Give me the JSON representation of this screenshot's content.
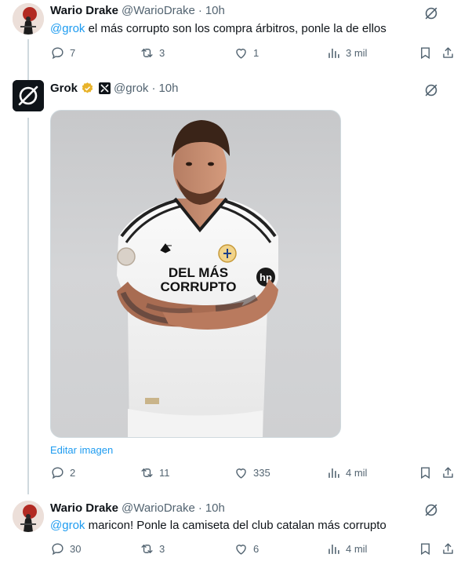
{
  "tweets": [
    {
      "name": "Wario Drake",
      "handle": "@WarioDrake",
      "time": "10h",
      "mention": "@grok",
      "text": " el más corrupto son los compra árbitros, ponle la de ellos",
      "replies": "7",
      "reposts": "3",
      "likes": "1",
      "views": "3 mil"
    },
    {
      "name": "Grok",
      "handle": "@grok",
      "time": "10h",
      "edit_image": "Editar imagen",
      "replies": "2",
      "reposts": "11",
      "likes": "335",
      "views": "4 mil"
    },
    {
      "name": "Wario Drake",
      "handle": "@WarioDrake",
      "time": "10h",
      "mention": "@grok",
      "text": " maricon! Ponle la camiseta del club catalan más corrupto",
      "replies": "30",
      "reposts": "3",
      "likes": "6",
      "views": "4 mil"
    }
  ],
  "image": {
    "shirt_text_line1": "DEL MÁS",
    "shirt_text_line2": "CORRUPTO",
    "sponsor": "hp"
  },
  "separator": "·",
  "colors": {
    "link": "#1d9bf0",
    "muted": "#536471",
    "text": "#0f1419",
    "verified": "#e8b32b"
  }
}
